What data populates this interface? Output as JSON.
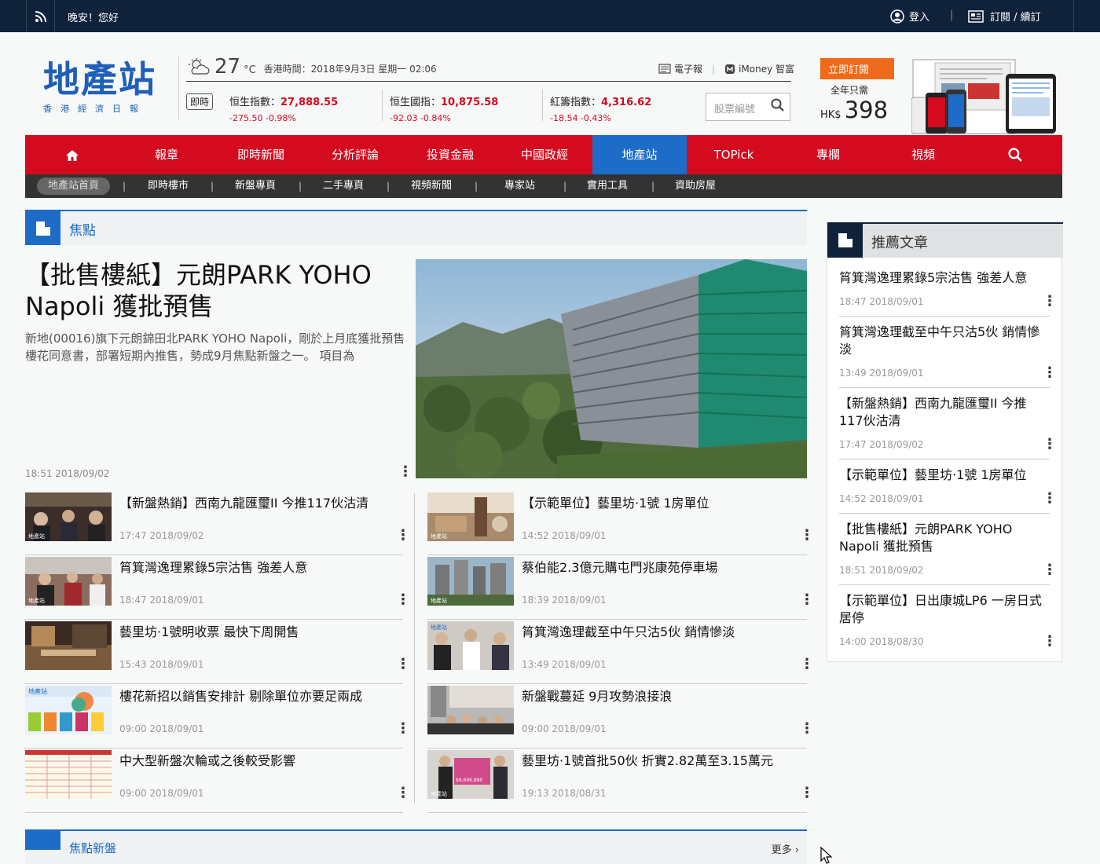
{
  "topbar": {
    "greeting": "晚安！您好",
    "login": "登入",
    "subscribe": "訂閱 / 續訂"
  },
  "logo": {
    "main": "地產站",
    "sub": "香港經濟日報"
  },
  "weather": {
    "temp": "27",
    "unit": "°C",
    "time": "香港時間：2018年9月3日 星期一 02:06"
  },
  "toplinks": {
    "epaper": "電子報",
    "imoney": "iMoney 智富"
  },
  "market": {
    "live": "即時",
    "indices": [
      {
        "name": "恒生指數：",
        "value": "27,888.55",
        "change": "-275.50 -0.98%"
      },
      {
        "name": "恒生國指：",
        "value": "10,875.58",
        "change": "-92.03 -0.84%"
      },
      {
        "name": "紅籌指數：",
        "value": "4,316.62",
        "change": "-18.54 -0.43%"
      }
    ],
    "stock_placeholder": "股票編號"
  },
  "promo": {
    "button": "立即訂閱",
    "period": "全年只需",
    "currency": "HK$",
    "price": "398"
  },
  "nav": [
    "報章",
    "即時新聞",
    "分析評論",
    "投資金融",
    "中國政經",
    "地產站",
    "TOPick",
    "專欄",
    "視頻"
  ],
  "subnav": {
    "home": "地產站首頁",
    "items": [
      "即時樓市",
      "新盤專頁",
      "二手專頁",
      "視頻新聞",
      "專家站",
      "實用工具",
      "資助房屋"
    ]
  },
  "focus": {
    "title": "焦點",
    "feature": {
      "title": "【批售樓紙】元朗PARK YOHO Napoli 獲批預售",
      "desc": "新地(00016)旗下元朗錦田北PARK YOHO Napoli，剛於上月底獲批預售樓花同意書，部署短期內推售，勢成9月焦點新盤之一。 項目為",
      "time": "18:51 2018/09/02"
    },
    "left": [
      {
        "title": "【新盤熱銷】西南九龍匯璽II 今推117伙沽清",
        "time": "17:47 2018/09/02"
      },
      {
        "title": "筲箕灣逸理累錄5宗沽售 強差人意",
        "time": "18:47 2018/09/01"
      },
      {
        "title": "藝里坊·1號明收票 最快下周開售",
        "time": "15:43 2018/09/01"
      },
      {
        "title": "樓花新招以銷售安排計 剔除單位亦要足兩成",
        "time": "09:00 2018/09/01"
      },
      {
        "title": "中大型新盤次輪或之後較受影響",
        "time": "09:00 2018/09/01"
      }
    ],
    "right": [
      {
        "title": "【示範單位】藝里坊·1號 1房單位",
        "time": "14:52 2018/09/01"
      },
      {
        "title": "蔡伯能2.3億元購屯門兆康苑停車場",
        "time": "18:39 2018/09/01"
      },
      {
        "title": "筲箕灣逸理截至中午只沽5伙 銷情慘淡",
        "time": "13:49 2018/09/01"
      },
      {
        "title": "新盤戰蔓延 9月攻勢浪接浪",
        "time": "09:00 2018/09/01"
      },
      {
        "title": "藝里坊·1號首批50伙 折實2.82萬至3.15萬元",
        "time": "19:13 2018/08/31"
      }
    ]
  },
  "thumb_text": {
    "watermark": "地產站",
    "price_tag": "$6,696,880"
  },
  "sidebar": {
    "title": "推薦文章",
    "items": [
      {
        "title": "筲箕灣逸理累錄5宗沽售 強差人意",
        "time": "18:47 2018/09/01"
      },
      {
        "title": "筲箕灣逸理截至中午只沽5伙 銷情慘淡",
        "time": "13:49 2018/09/01"
      },
      {
        "title": "【新盤熱銷】西南九龍匯璽II 今推117伙沽清",
        "time": "17:47 2018/09/02"
      },
      {
        "title": "【示範單位】藝里坊·1號 1房單位",
        "time": "14:52 2018/09/01"
      },
      {
        "title": "【批售樓紙】元朗PARK YOHO Napoli 獲批預售",
        "time": "18:51 2018/09/02"
      },
      {
        "title": "【示範單位】日出康城LP6 一房日式居停",
        "time": "14:00 2018/08/30"
      }
    ]
  },
  "bottom": {
    "title": "焦點新盤",
    "more": "更多"
  },
  "colors": {
    "brand_blue": "#1c6cc8",
    "nav_red": "#d40a1f",
    "topbar": "#10223a",
    "index_red": "#d10a1d",
    "promo_orange": "#ef6a1a"
  },
  "icons": [
    "rss-icon",
    "user-icon",
    "newspaper-icon",
    "weather-icon",
    "search-icon",
    "home-icon",
    "section-icon",
    "more-dots-icon",
    "chevron-right-icon",
    "cursor-icon"
  ]
}
